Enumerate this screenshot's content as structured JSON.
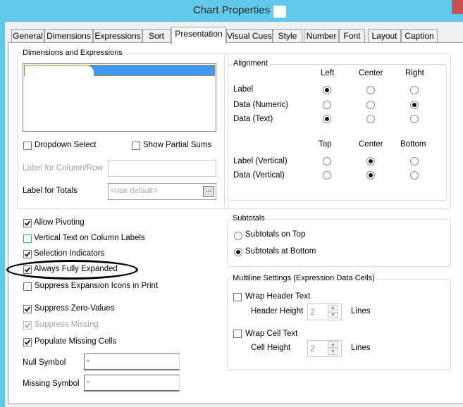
{
  "window": {
    "title": "Chart Properties",
    "close_label": "X"
  },
  "tabs": [
    {
      "label": "General",
      "active": false
    },
    {
      "label": "Dimensions",
      "active": false
    },
    {
      "label": "Expressions",
      "active": false
    },
    {
      "label": "Sort",
      "active": false
    },
    {
      "label": "Presentation",
      "active": true
    },
    {
      "label": "Visual Cues",
      "active": false
    },
    {
      "label": "Style",
      "active": false
    },
    {
      "label": "Number",
      "active": false
    },
    {
      "label": "Font",
      "active": false
    },
    {
      "label": "Layout",
      "active": false
    },
    {
      "label": "Caption",
      "active": false
    }
  ],
  "dimensions_expressions": {
    "group_label": "Dimensions and Expressions",
    "items_redacted": true,
    "dropdown_select": {
      "label": "Dropdown Select",
      "checked": false
    },
    "show_partial_sums": {
      "label": "Show Partial Sums",
      "checked": false
    },
    "label_for_column_row": {
      "label": "Label for Column/Row",
      "value": "",
      "disabled": true
    },
    "label_for_totals": {
      "label": "Label for Totals",
      "placeholder": "<use default>",
      "button_label": "..."
    }
  },
  "alignment": {
    "group_label": "Alignment",
    "horizontal_columns": [
      "Left",
      "Center",
      "Right"
    ],
    "horizontal_rows": [
      {
        "label": "Label",
        "selected": "Left"
      },
      {
        "label": "Data (Numeric)",
        "selected": "Right"
      },
      {
        "label": "Data (Text)",
        "selected": "Left"
      }
    ],
    "vertical_columns": [
      "Top",
      "Center",
      "Bottom"
    ],
    "vertical_rows": [
      {
        "label": "Label (Vertical)",
        "selected": "Center"
      },
      {
        "label": "Data (Vertical)",
        "selected": "Center"
      }
    ]
  },
  "options": {
    "allow_pivoting": {
      "label": "Allow Pivoting",
      "checked": true
    },
    "vertical_text": {
      "label": "Vertical Text on Column Labels",
      "checked": false
    },
    "selection_indicators": {
      "label": "Selection Indicators",
      "checked": true
    },
    "always_fully_expanded": {
      "label": "Always Fully Expanded",
      "checked": true,
      "highlighted": true
    },
    "suppress_expansion_icons": {
      "label": "Suppress Expansion Icons in Print",
      "checked": false
    },
    "suppress_zero_values": {
      "label": "Suppress Zero-Values",
      "checked": true
    },
    "suppress_missing": {
      "label": "Suppress Missing",
      "checked": true,
      "disabled": true
    },
    "populate_missing_cells": {
      "label": "Populate Missing Cells",
      "checked": true
    },
    "null_symbol": {
      "label": "Null Symbol",
      "value": "-"
    },
    "missing_symbol": {
      "label": "Missing Symbol",
      "value": "-"
    }
  },
  "subtotals": {
    "group_label": "Subtotals",
    "on_top": {
      "label": "Subtotals on Top",
      "selected": false
    },
    "at_bottom": {
      "label": "Subtotals at Bottom",
      "selected": true
    }
  },
  "multiline": {
    "group_label": "Multiline Settings (Expression Data Cells)",
    "wrap_header_text": {
      "label": "Wrap Header Text",
      "checked": false
    },
    "header_height": {
      "label": "Header Height",
      "value": "2",
      "unit": "Lines"
    },
    "wrap_cell_text": {
      "label": "Wrap Cell Text",
      "checked": false
    },
    "cell_height": {
      "label": "Cell Height",
      "value": "2",
      "unit": "Lines"
    }
  }
}
